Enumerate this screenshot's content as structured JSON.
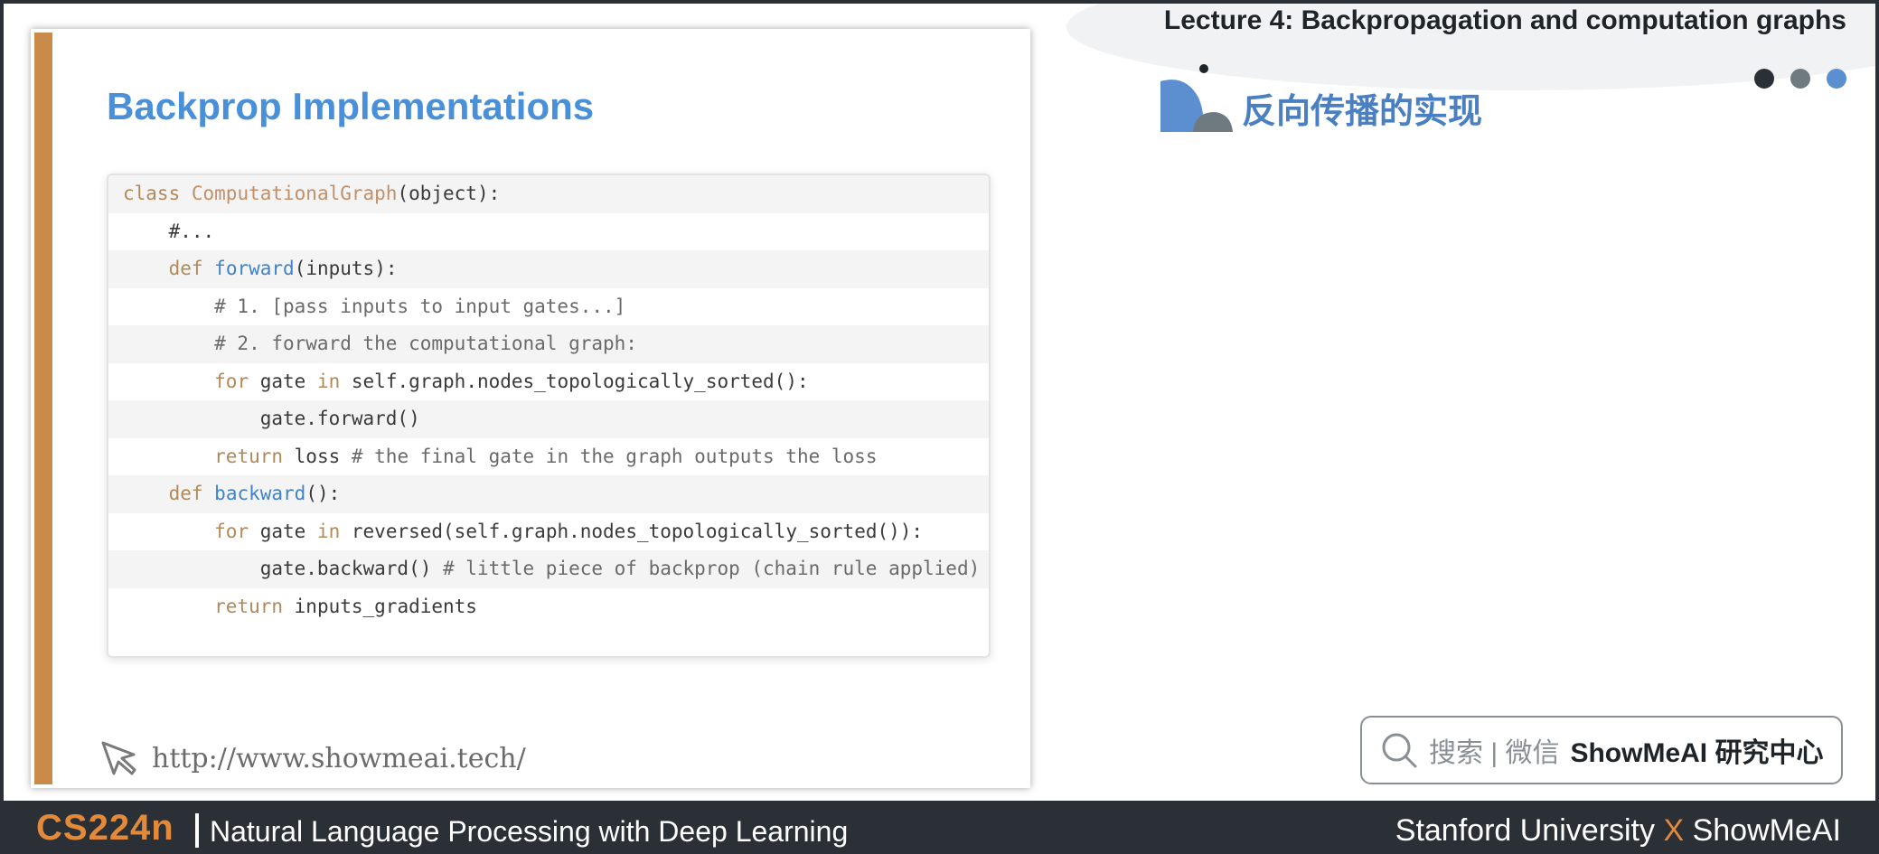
{
  "header": {
    "lecture_title": "Lecture 4:  Backpropagation and computation graphs",
    "topic_title": "反向传播的实现"
  },
  "slide": {
    "heading": "Backprop Implementations",
    "code_lines": [
      "class ComputationalGraph(object):",
      "    #...",
      "    def forward(inputs):",
      "        # 1. [pass inputs to input gates...]",
      "        # 2. forward the computational graph:",
      "        for gate in self.graph.nodes_topologically_sorted():",
      "            gate.forward()",
      "        return loss # the final gate in the graph outputs the loss",
      "    def backward():",
      "        for gate in reversed(self.graph.nodes_topologically_sorted()):",
      "            gate.backward() # little piece of backprop (chain rule applied)",
      "        return inputs_gradients"
    ],
    "url": "http://www.showmeai.tech/"
  },
  "search": {
    "hint": "搜索 | 微信",
    "brand": "ShowMeAI 研究中心"
  },
  "footer": {
    "course_code": "CS224n",
    "course_name": "Natural Language Processing with Deep Learning",
    "credits_left": "Stanford University",
    "credits_x": "X",
    "credits_right": "ShowMeAI"
  },
  "icons": [
    "cursor-icon",
    "search-icon"
  ],
  "colors": {
    "accent_orange": "#e2893a",
    "slide_bar": "#c98a4a",
    "heading_blue": "#4a90d9",
    "topic_blue": "#4a7fc1",
    "dark_bar": "#2b2f36",
    "dot_1": "#2b2f36",
    "dot_2": "#6f7a80",
    "dot_3": "#5b8fd0"
  }
}
